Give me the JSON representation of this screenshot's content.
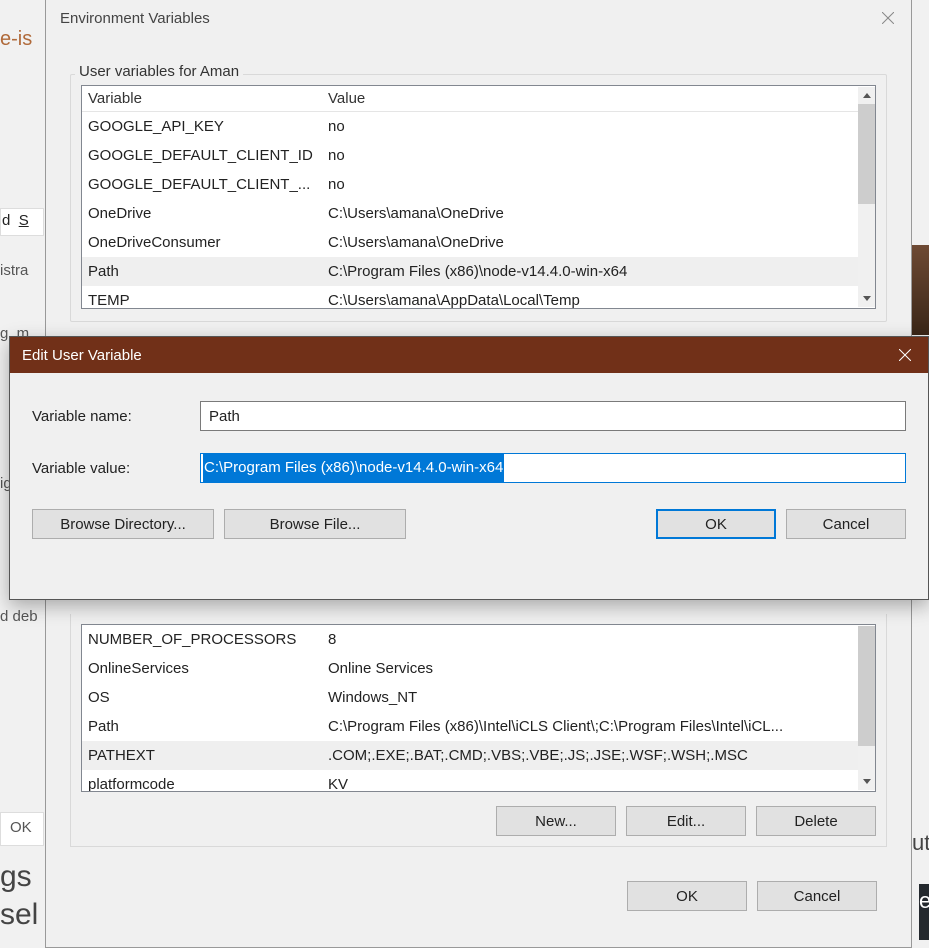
{
  "env_dialog": {
    "title": "Environment Variables",
    "user_section_legend": "User variables for Aman",
    "headers": {
      "variable": "Variable",
      "value": "Value"
    },
    "user_vars": [
      {
        "name": "GOOGLE_API_KEY",
        "value": "no"
      },
      {
        "name": "GOOGLE_DEFAULT_CLIENT_ID",
        "value": "no"
      },
      {
        "name": "GOOGLE_DEFAULT_CLIENT_...",
        "value": "no"
      },
      {
        "name": "OneDrive",
        "value": "C:\\Users\\amana\\OneDrive"
      },
      {
        "name": "OneDriveConsumer",
        "value": "C:\\Users\\amana\\OneDrive"
      },
      {
        "name": "Path",
        "value": "C:\\Program Files (x86)\\node-v14.4.0-win-x64",
        "selected": true
      },
      {
        "name": "TEMP",
        "value": "C:\\Users\\amana\\AppData\\Local\\Temp"
      }
    ],
    "sys_vars": [
      {
        "name": "NUMBER_OF_PROCESSORS",
        "value": "8"
      },
      {
        "name": "OnlineServices",
        "value": "Online Services"
      },
      {
        "name": "OS",
        "value": "Windows_NT"
      },
      {
        "name": "Path",
        "value": "C:\\Program Files (x86)\\Intel\\iCLS Client\\;C:\\Program Files\\Intel\\iCL..."
      },
      {
        "name": "PATHEXT",
        "value": ".COM;.EXE;.BAT;.CMD;.VBS;.VBE;.JS;.JSE;.WSF;.WSH;.MSC",
        "selected": true
      },
      {
        "name": "platformcode",
        "value": "KV"
      }
    ],
    "buttons": {
      "new": "New...",
      "edit": "Edit...",
      "delete": "Delete",
      "ok": "OK",
      "cancel": "Cancel"
    }
  },
  "edit_dialog": {
    "title": "Edit User Variable",
    "name_label": "Variable name:",
    "value_label": "Variable value:",
    "name_value": "Path",
    "value_value": "C:\\Program Files (x86)\\node-v14.4.0-win-x64",
    "buttons": {
      "browse_dir": "Browse Directory...",
      "browse_file": "Browse File...",
      "ok": "OK",
      "cancel": "Cancel"
    }
  },
  "bg": {
    "f1": "e-is",
    "f2": "d",
    "f3": "S",
    "f4": "istra",
    "f5": "g, m",
    "f6": "ig",
    "f7": "d deb",
    "f8": "OK",
    "f9": "gs",
    "f10": "sel",
    "f11": "ut",
    "f12": "e"
  }
}
